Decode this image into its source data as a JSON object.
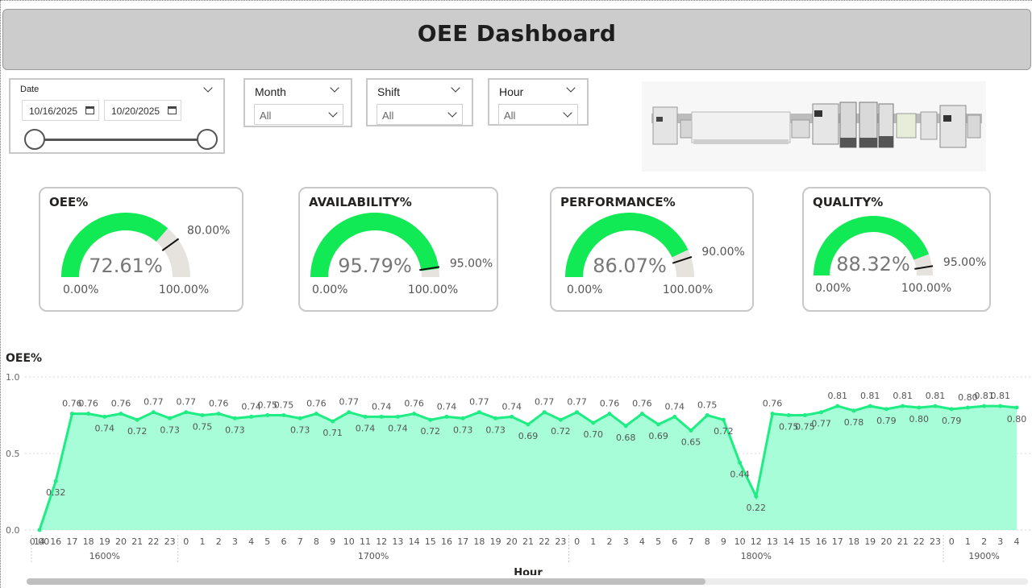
{
  "header": {
    "title": "OEE Dashboard"
  },
  "slicers": {
    "date": {
      "title": "Date",
      "start": "10/16/2025",
      "end": "10/20/2025"
    },
    "month": {
      "title": "Month",
      "value": "All"
    },
    "shift": {
      "title": "Shift",
      "value": "All"
    },
    "hour": {
      "title": "Hour",
      "value": "All"
    }
  },
  "kpis": [
    {
      "title": "OEE%",
      "value": "72.61%",
      "value_num": 72.61,
      "target": "80.00%",
      "target_num": 80.0,
      "min": "0.00%",
      "max": "100.00%"
    },
    {
      "title": "AVAILABILITY%",
      "value": "95.79%",
      "value_num": 95.79,
      "target": "95.00%",
      "target_num": 95.0,
      "min": "0.00%",
      "max": "100.00%"
    },
    {
      "title": "PERFORMANCE%",
      "value": "86.07%",
      "value_num": 86.07,
      "target": "90.00%",
      "target_num": 90.0,
      "min": "0.00%",
      "max": "100.00%"
    },
    {
      "title": "QUALITY%",
      "value": "88.32%",
      "value_num": 88.32,
      "target": "95.00%",
      "target_num": 95.0,
      "min": "0.00%",
      "max": "100.00%"
    }
  ],
  "colors": {
    "accent": "#11ea54",
    "gauge_bg": "#e6e2dd",
    "area_fill": "#a6fdd7",
    "area_line": "#1ded83"
  },
  "chart_data": {
    "type": "area",
    "title": "OEE%",
    "xlabel": "Hour",
    "ylabel": "",
    "ylim": [
      0,
      1.0
    ],
    "yticks": [
      "0.0",
      "0.5",
      "1.0"
    ],
    "groups": [
      {
        "label": "1600%",
        "hours": [
          "14",
          "16",
          "17",
          "18",
          "19",
          "20",
          "21",
          "22",
          "23"
        ]
      },
      {
        "label": "1700%",
        "hours": [
          "0",
          "1",
          "2",
          "3",
          "4",
          "5",
          "6",
          "7",
          "8",
          "9",
          "10",
          "11",
          "12",
          "13",
          "14",
          "15",
          "16",
          "17",
          "18",
          "19",
          "20",
          "21",
          "22",
          "23"
        ]
      },
      {
        "label": "1800%",
        "hours": [
          "0",
          "1",
          "2",
          "3",
          "4",
          "5",
          "6",
          "7",
          "8",
          "9",
          "10",
          "12",
          "13",
          "14",
          "15",
          "16",
          "17",
          "18",
          "19",
          "20",
          "21",
          "22",
          "23"
        ]
      },
      {
        "label": "1900%",
        "hours": [
          "0",
          "1",
          "2",
          "3",
          "4"
        ]
      }
    ],
    "values": [
      0.0,
      0.32,
      0.76,
      0.76,
      0.74,
      0.76,
      0.72,
      0.77,
      0.73,
      0.77,
      0.75,
      0.76,
      0.73,
      0.74,
      0.75,
      0.75,
      0.73,
      0.76,
      0.71,
      0.77,
      0.74,
      0.74,
      0.74,
      0.76,
      0.72,
      0.74,
      0.73,
      0.77,
      0.73,
      0.74,
      0.69,
      0.77,
      0.72,
      0.77,
      0.7,
      0.76,
      0.68,
      0.76,
      0.69,
      0.74,
      0.65,
      0.75,
      0.72,
      0.44,
      0.22,
      0.76,
      0.75,
      0.75,
      0.77,
      0.81,
      0.78,
      0.81,
      0.79,
      0.81,
      0.8,
      0.81,
      0.79,
      0.8,
      0.81,
      0.81,
      0.8
    ]
  }
}
